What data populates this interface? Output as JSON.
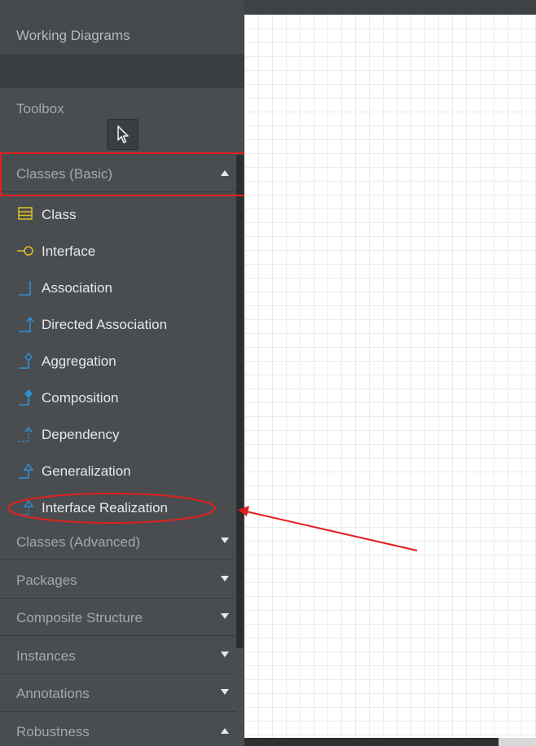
{
  "working_diagrams": {
    "title": "Working Diagrams"
  },
  "toolbox": {
    "title": "Toolbox",
    "pointer_icon": "cursor-arrow-icon"
  },
  "sections": {
    "classes_basic": {
      "title": "Classes (Basic)",
      "expanded": true,
      "items": [
        {
          "label": "Class",
          "icon": "class-icon"
        },
        {
          "label": "Interface",
          "icon": "interface-icon"
        },
        {
          "label": "Association",
          "icon": "association-icon"
        },
        {
          "label": "Directed Association",
          "icon": "directed-association-icon"
        },
        {
          "label": "Aggregation",
          "icon": "aggregation-icon"
        },
        {
          "label": "Composition",
          "icon": "composition-icon"
        },
        {
          "label": "Dependency",
          "icon": "dependency-icon"
        },
        {
          "label": "Generalization",
          "icon": "generalization-icon"
        },
        {
          "label": "Interface Realization",
          "icon": "interface-realization-icon"
        }
      ]
    },
    "collapsed": [
      {
        "title": "Classes (Advanced)",
        "expanded": false
      },
      {
        "title": "Packages",
        "expanded": false
      },
      {
        "title": "Composite Structure",
        "expanded": false
      },
      {
        "title": "Instances",
        "expanded": false
      },
      {
        "title": "Annotations",
        "expanded": false
      },
      {
        "title": "Robustness",
        "expanded": true
      }
    ]
  },
  "colors": {
    "sidebar_bg": "#4a4d50",
    "icon_blue": "#2f8fd8",
    "icon_yellow": "#e0c020",
    "annotation_red": "#e02020"
  }
}
